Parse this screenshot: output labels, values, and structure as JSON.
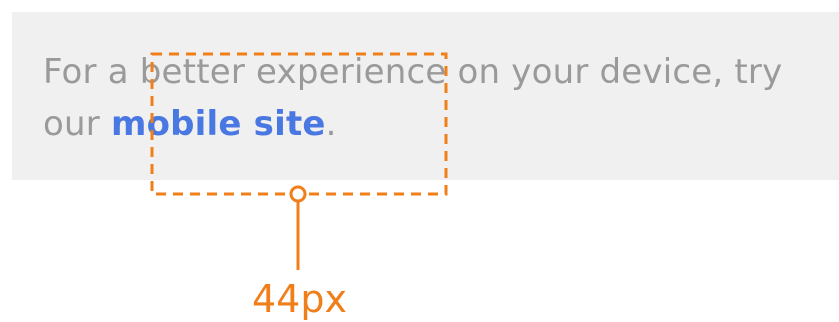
{
  "banner": {
    "text_before": "For a better experience on your device, try our ",
    "link_text": "mobile site",
    "text_after": "."
  },
  "annotation": {
    "size_label": "44px",
    "accent_color": "#f07f1a"
  },
  "colors": {
    "banner_background": "#f0f0f0",
    "body_text": "#9a9a9a",
    "link": "#4a78e2"
  }
}
